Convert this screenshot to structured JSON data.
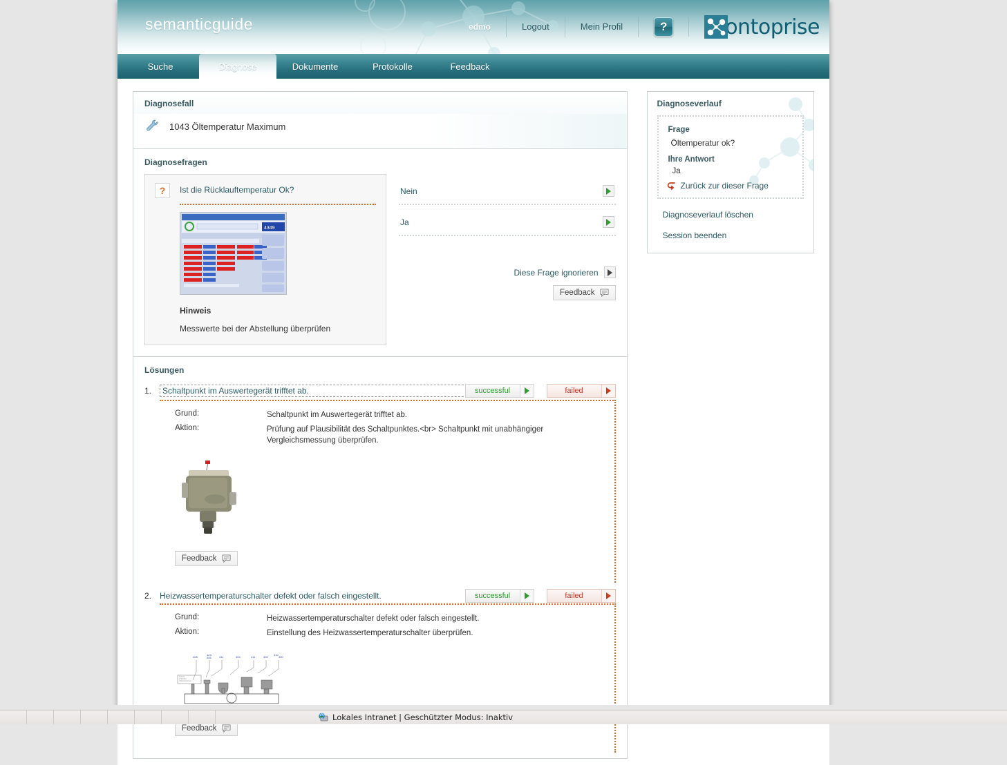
{
  "header": {
    "product_name": "semanticguide",
    "user": "edmo",
    "logout_label": "Logout",
    "profile_label": "Mein Profil",
    "help_label": "?",
    "company_logo_text": "ontoprise",
    "accent_color": "#2a7f96"
  },
  "nav": {
    "items": [
      {
        "label": "Suche",
        "active": false
      },
      {
        "label": "Diagnose",
        "active": true
      },
      {
        "label": "Dokumente",
        "active": false
      },
      {
        "label": "Protokolle",
        "active": false
      },
      {
        "label": "Feedback",
        "active": false
      }
    ]
  },
  "diagnosefall": {
    "panel_title": "Diagnosefall",
    "case_title": "1043 Öltemperatur Maximum",
    "icon": "wrench-icon"
  },
  "diagnosefragen": {
    "section_title": "Diagnosefragen",
    "question_marker": "?",
    "question_text": "Ist die Rücklauftemperatur Ok?",
    "thumbnail_alt": "Netzparallelbetrieb Messwerte Screenshot",
    "hint_title": "Hinweis",
    "hint_text": "Messwerte bei der Abstellung überprüfen",
    "answers": [
      {
        "label": "Nein"
      },
      {
        "label": "Ja"
      }
    ],
    "ignore_label": "Diese Frage ignorieren",
    "feedback_label": "Feedback"
  },
  "loesungen": {
    "section_title": "Lösungen",
    "detail_keys": {
      "grund": "Grund:",
      "aktion": "Aktion:"
    },
    "state_success_label": "successful",
    "state_failed_label": "failed",
    "feedback_label": "Feedback",
    "items": [
      {
        "number": "1.",
        "title": "Schaltpunkt im Auswertegerät trifftet ab.",
        "grund": "Schaltpunkt im Auswertegerät trifftet ab.",
        "aktion": "Prüfung auf Plausibilität des Schaltpunktes.<br> Schaltpunkt mit unabhängiger Vergleichsmessung überprüfen.",
        "image_alt": "Druckschalter / Pressure switch photo"
      },
      {
        "number": "2.",
        "title": "Heizwassertemperaturschalter defekt oder falsch eingestellt.",
        "grund": "Heizwassertemperaturschalter defekt oder falsch eingestellt.",
        "aktion": "Einstellung des Heizwassertemperaturschalter überprüfen.",
        "image_alt": "Technische Zeichnung Ventile Leiste"
      }
    ]
  },
  "sidebar": {
    "panel_title": "Diagnoseverlauf",
    "history": {
      "frage_label": "Frage",
      "frage_text": "Öltemperatur ok?",
      "antwort_label": "Ihre Antwort",
      "antwort_text": "Ja",
      "back_link": "Zurück zur dieser Frage"
    },
    "links": [
      {
        "label": "Diagnoseverlauf löschen"
      },
      {
        "label": "Session beenden"
      }
    ]
  },
  "statusbar": {
    "zone_text": "Lokales Intranet | Geschützter Modus: Inaktiv",
    "icon": "globe-monitor-icon"
  }
}
